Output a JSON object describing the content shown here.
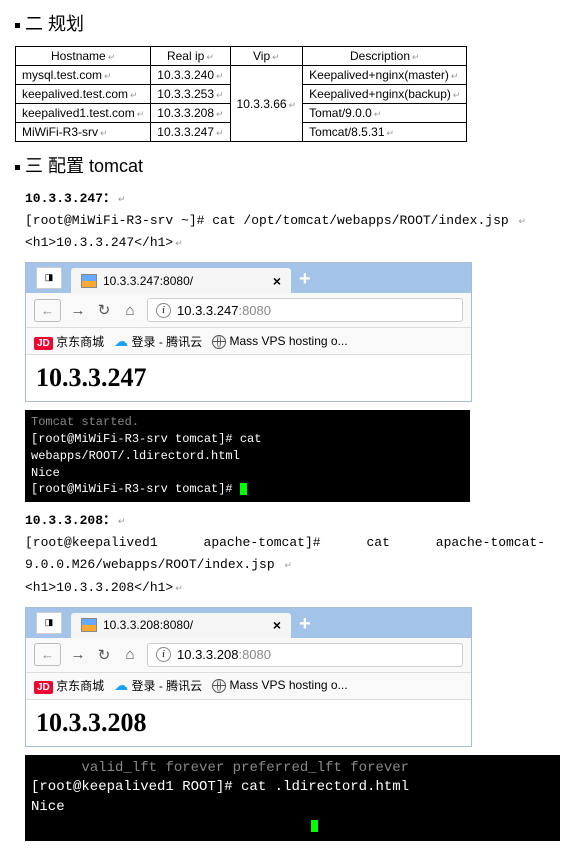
{
  "section2": {
    "title": "二  规划"
  },
  "table": {
    "headers": [
      "Hostname",
      "Real ip",
      "Vip",
      "Description"
    ],
    "rows": [
      {
        "host": "mysql.test.com",
        "real": "10.3.3.240",
        "desc": "Keepalived+nginx(master)"
      },
      {
        "host": "keepalived.test.com",
        "real": "10.3.3.253",
        "desc": "Keepalived+nginx(backup)"
      },
      {
        "host": "keepalived1.test.com",
        "real": "10.3.3.208",
        "desc": "Tomat/9.0.0"
      },
      {
        "host": "MiWiFi-R3-srv",
        "real": "10.3.3.247",
        "desc": "Tomcat/8.5.31"
      }
    ],
    "vip": "10.3.3.66"
  },
  "section3": {
    "title": "三  配置 tomcat"
  },
  "block247": {
    "ip_label": "10.3.3.247：",
    "cmd": "[root@MiWiFi-R3-srv ~]# cat /opt/tomcat/webapps/ROOT/index.jsp",
    "html": "<h1>10.3.3.247</h1>",
    "browser": {
      "tab_title": "10.3.3.247:8080/",
      "url_host": "10.3.3.247",
      "url_port": ":8080",
      "bm1": "京东商城",
      "bm2": "登录 - 腾讯云",
      "bm3": "Mass VPS hosting o...",
      "page": "10.3.3.247"
    },
    "terminal": "Tomcat started.\n[root@MiWiFi-R3-srv tomcat]# cat webapps/ROOT/.ldirectord.html\nNice\n[root@MiWiFi-R3-srv tomcat]# "
  },
  "block208": {
    "ip_label": "10.3.3.208：",
    "cmd_p1": "[root@keepalived1",
    "cmd_p2": "apache-tomcat]#",
    "cmd_p3": "cat",
    "cmd_p4": "apache-tomcat-",
    "cmd2": "9.0.0.M26/webapps/ROOT/index.jsp",
    "html": "<h1>10.3.3.208</h1>",
    "browser": {
      "tab_title": "10.3.3.208:8080/",
      "url_host": "10.3.3.208",
      "url_port": ":8080",
      "bm1": "京东商城",
      "bm2": "登录 - 腾讯云",
      "bm3": "Mass VPS hosting o...",
      "page": "10.3.3.208"
    },
    "terminal": "      valid_lft forever preferred_lft forever\n[root@keepalived1 ROOT]# cat .ldirectord.html\nNice"
  }
}
